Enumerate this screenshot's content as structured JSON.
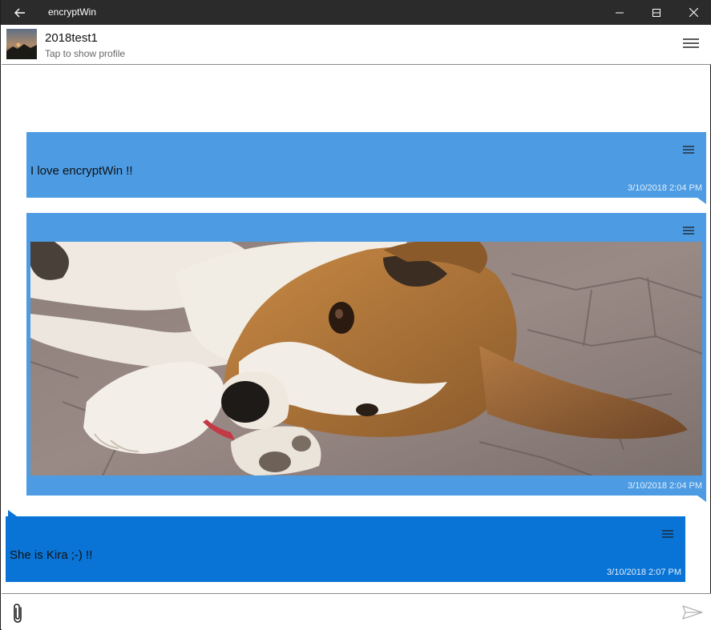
{
  "window": {
    "title": "encryptWin"
  },
  "header": {
    "contact_name": "2018test1",
    "subtitle": "Tap to show profile"
  },
  "messages": [
    {
      "type": "text",
      "text": "I love encryptWin !!",
      "time": "3/10/2018 2:04 PM",
      "direction": "outgoing",
      "color": "#4c9be3"
    },
    {
      "type": "image",
      "image_desc_icon": "dog-photo",
      "time": "3/10/2018 2:04 PM",
      "direction": "outgoing",
      "color": "#4c9be3"
    },
    {
      "type": "text",
      "text": "She is Kira ;-) !!",
      "time": "3/10/2018 2:07 PM",
      "direction": "incoming",
      "color": "#0a74d6"
    }
  ],
  "composer": {
    "attach_icon": "paperclip-icon",
    "send_icon": "send-icon"
  },
  "colors": {
    "titlebar": "#2b2b2b",
    "outgoing": "#4c9be3",
    "incoming": "#0a74d6"
  }
}
